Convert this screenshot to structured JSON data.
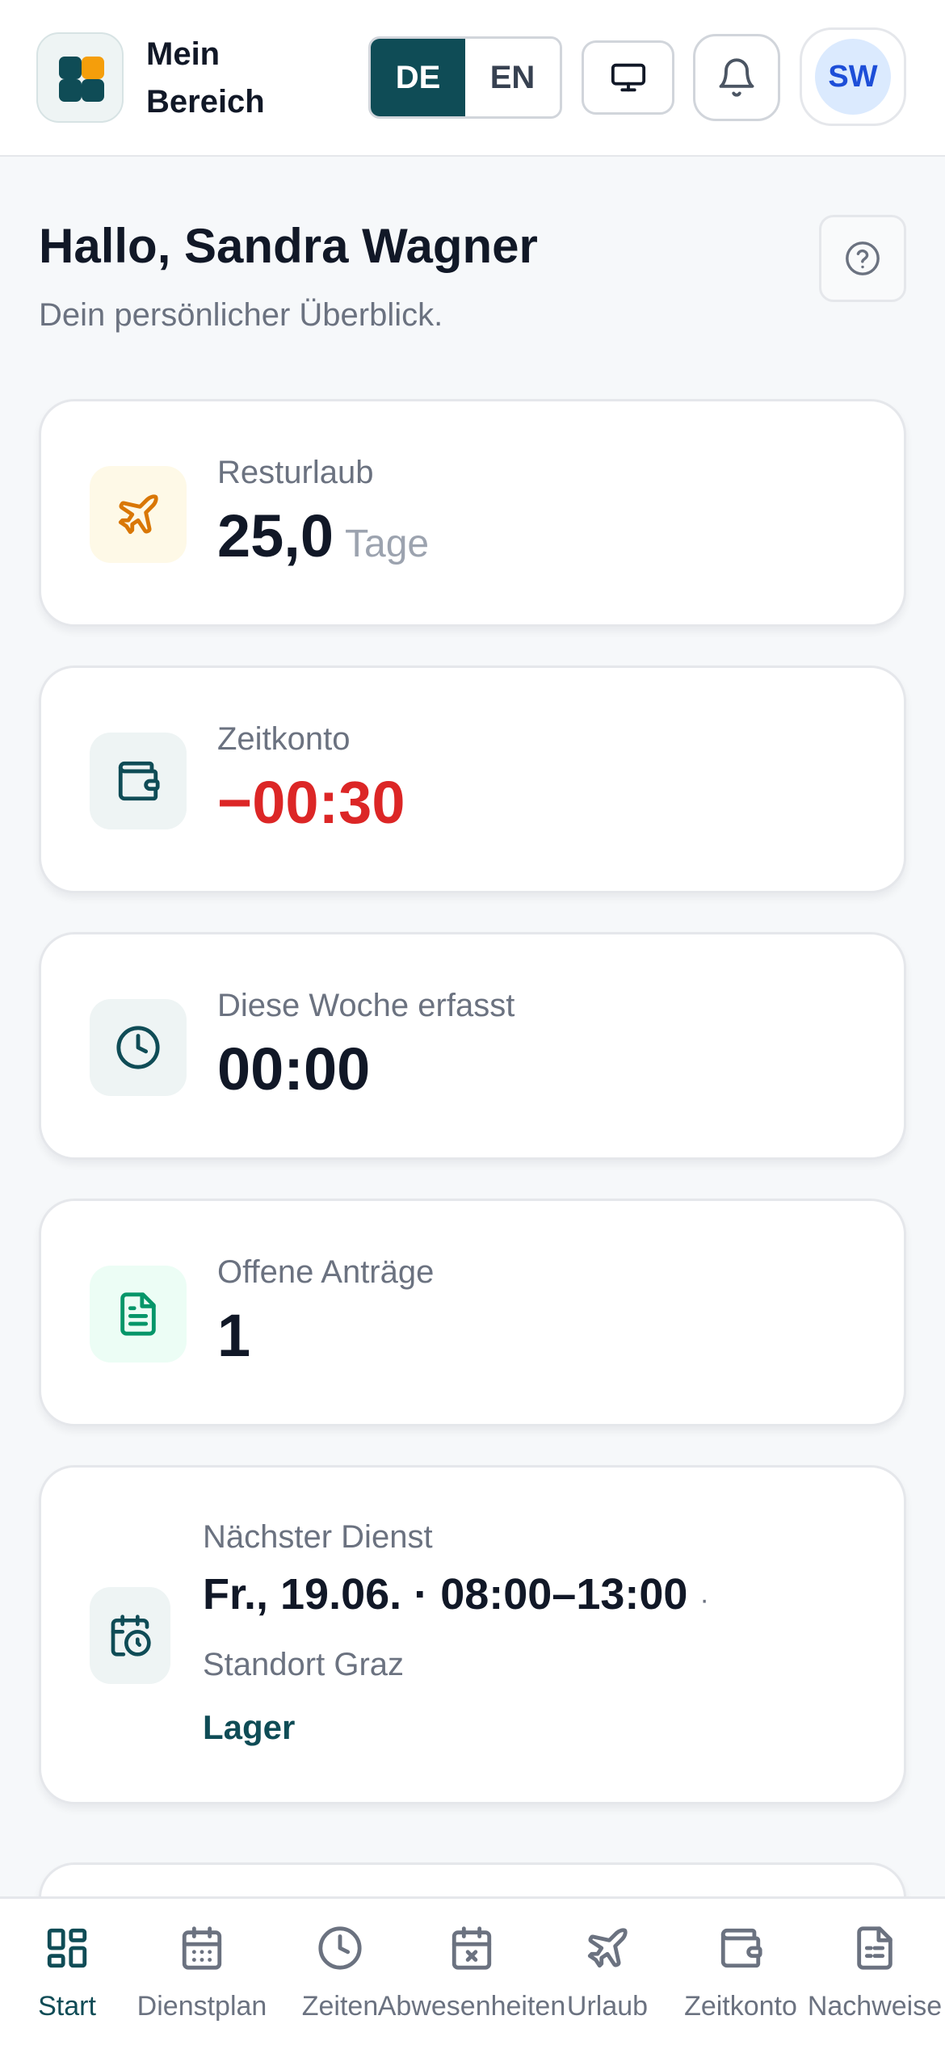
{
  "header": {
    "app_title": "Mein Bereich",
    "languages": [
      {
        "code": "DE",
        "active": true
      },
      {
        "code": "EN",
        "active": false
      }
    ],
    "user_initials": "SW",
    "icons": {
      "logo": "grid-logo-icon",
      "display": "monitor-icon",
      "notifications": "bell-icon",
      "help": "help-circle-icon"
    }
  },
  "greeting": {
    "title": "Hallo, Sandra Wagner",
    "subtitle": "Dein persönlicher Überblick."
  },
  "cards": {
    "vacation": {
      "label": "Resturlaub",
      "value": "25,0",
      "unit": "Tage",
      "icon": "plane-icon",
      "accent": "#d97706",
      "icon_bg": "#fef9e7"
    },
    "time_account": {
      "label": "Zeitkonto",
      "value": "−00:30",
      "icon": "wallet-icon",
      "accent": "#dc2626",
      "icon_bg": "#eef4f4"
    },
    "week": {
      "label": "Diese Woche erfasst",
      "value": "00:00",
      "icon": "clock-icon",
      "icon_bg": "#eef4f4"
    },
    "requests": {
      "label": "Offene Anträge",
      "value": "1",
      "icon": "document-icon",
      "accent": "#059669",
      "icon_bg": "#ecfdf5"
    },
    "next_shift": {
      "label": "Nächster Dienst",
      "date": "Fr., 19.06.",
      "separator": "·",
      "time": "08:00–13:00",
      "trailing_separator": "·",
      "location": "Standort Graz",
      "area": "Lager",
      "icon": "calendar-clock-icon",
      "icon_bg": "#eef4f4"
    }
  },
  "nav": {
    "items": [
      {
        "label": "Start",
        "icon": "dashboard-icon",
        "active": true
      },
      {
        "label": "Dienstplan",
        "icon": "calendar-grid-icon",
        "active": false
      },
      {
        "label": "Zeiten",
        "icon": "clock-icon",
        "active": false
      },
      {
        "label": "Abwesenheiten",
        "icon": "calendar-x-icon",
        "active": false
      },
      {
        "label": "Urlaub",
        "icon": "plane-icon",
        "active": false
      },
      {
        "label": "Zeitkonto",
        "icon": "wallet-icon",
        "active": false
      },
      {
        "label": "Nachweise",
        "icon": "file-list-icon",
        "active": false
      }
    ]
  },
  "colors": {
    "brand": "#0f4c56",
    "background": "#f6f8fa",
    "muted_text": "#6b7280",
    "negative": "#dc2626"
  }
}
